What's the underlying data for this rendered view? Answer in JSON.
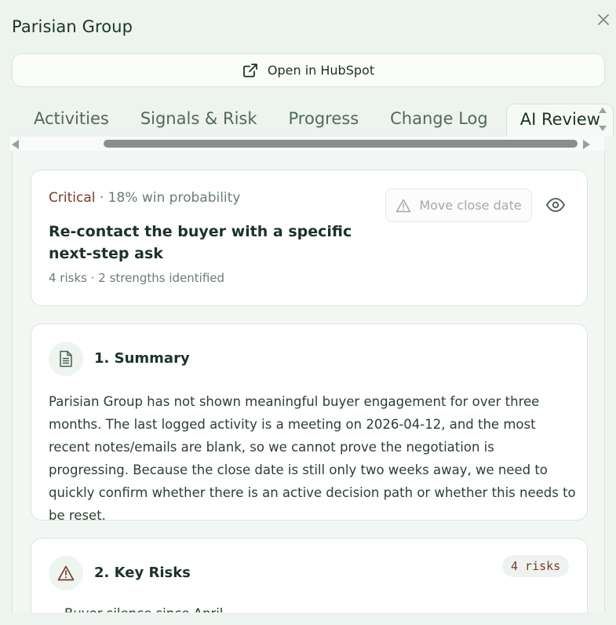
{
  "panel": {
    "title": "Parisian Group"
  },
  "open_button": {
    "label": "Open in HubSpot"
  },
  "tabs": [
    {
      "label": "Activities"
    },
    {
      "label": "Signals & Risk"
    },
    {
      "label": "Progress"
    },
    {
      "label": "Change Log"
    },
    {
      "label": "AI Review",
      "active": true
    }
  ],
  "review": {
    "severity": "Critical",
    "win_probability": "· 18% win probability",
    "headline": "Re-contact the buyer with a specific next-step ask",
    "meta": "4 risks · 2 strengths identified",
    "move_close_date_label": "Move close date"
  },
  "summary": {
    "title": "1. Summary",
    "text": "Parisian Group has not shown meaningful buyer engagement for over three months. The last logged activity is a meeting on 2026-04-12, and the most recent notes/emails are blank, so we cannot prove the negotiation is progressing. Because the close date is still only two weeks away, we need to quickly confirm whether there is an active decision path or whether this needs to be reset."
  },
  "key_risks": {
    "title": "2. Key Risks",
    "badge": "4 risks",
    "first_item_partial": "Buyer silence since April"
  },
  "colors": {
    "critical": "#7a3a2c",
    "background": "#edf3ee",
    "accent": "#1c3327"
  }
}
